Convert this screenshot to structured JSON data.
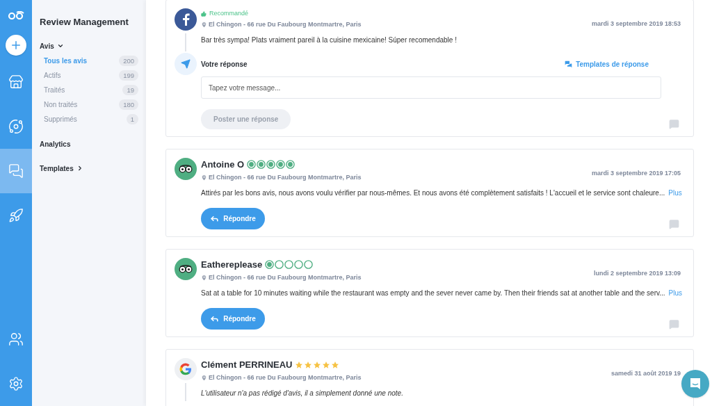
{
  "rail": {
    "items": [
      {
        "kind": "store",
        "selected": false
      },
      {
        "kind": "planet",
        "selected": false
      },
      {
        "kind": "chat",
        "selected": true
      },
      {
        "kind": "rocket",
        "selected": false
      }
    ],
    "bottom": [
      {
        "kind": "users",
        "selected": false
      },
      {
        "kind": "settings",
        "selected": false
      }
    ]
  },
  "sidebar": {
    "title": "Review Management",
    "sections": [
      {
        "label": "Avis",
        "expanded": true,
        "items": [
          {
            "label": "Tous les avis",
            "count": "200",
            "selected": true
          },
          {
            "label": "Actifs",
            "count": "199",
            "selected": false
          },
          {
            "label": "Traités",
            "count": "19",
            "selected": false
          },
          {
            "label": "Non traités",
            "count": "180",
            "selected": false
          },
          {
            "label": "Supprimés",
            "count": "1",
            "selected": false
          }
        ]
      },
      {
        "label": "Analytics"
      },
      {
        "label": "Templates",
        "expanded": false
      }
    ]
  },
  "reviews": [
    {
      "kind": "facebook",
      "recommended": "Recommandé",
      "location": "El Chingon - 66 rue Du Faubourg Montmartre, Paris",
      "date": "mardi 3 septembre 2019 18:53",
      "text": "Bar très sympa! Plats vraiment pareil à la cuisine mexicaine! Súper recomendable !",
      "italic": false,
      "reply_form": {
        "label": "Votre réponse",
        "templates": "Templates de réponse",
        "placeholder": "Tapez votre message...",
        "post_button": "Poster une réponse",
        "disabled": true
      }
    },
    {
      "kind": "tripadvisor",
      "author": "Antoine O",
      "stars": 5,
      "location": "El Chingon - 66 rue Du Faubourg Montmartre, Paris",
      "date": "mardi 3 septembre 2019 17:05",
      "text": "Attirés par les bons avis, nous avons voulu vérifier par nous-mêmes. Et nous avons été complètement satisfaits ! L'accueil et le service sont chaleure...",
      "more": "Plus",
      "italic": false,
      "reply_button": "Répondre"
    },
    {
      "kind": "tripadvisor",
      "author": "Eathereplease",
      "stars": 1,
      "location": "El Chingon - 66 rue Du Faubourg Montmartre, Paris",
      "date": "lundi 2 septembre 2019 13:09",
      "text": "Sat at a table for 10 minutes waiting while the restaurant was empty and the sever never came by. Then their friends sat at another table and the serv...",
      "more": "Plus",
      "italic": false,
      "reply_button": "Répondre"
    },
    {
      "kind": "google",
      "author": "Clément PERRINEAU",
      "stars": 5,
      "location": "El Chingon - 66 rue Du Faubourg Montmartre, Paris",
      "date": "samedi 31 août 2019 19",
      "text": "L'utilisateur n'a pas rédigé d'avis, il a simplement donné une note.",
      "italic": true
    }
  ]
}
